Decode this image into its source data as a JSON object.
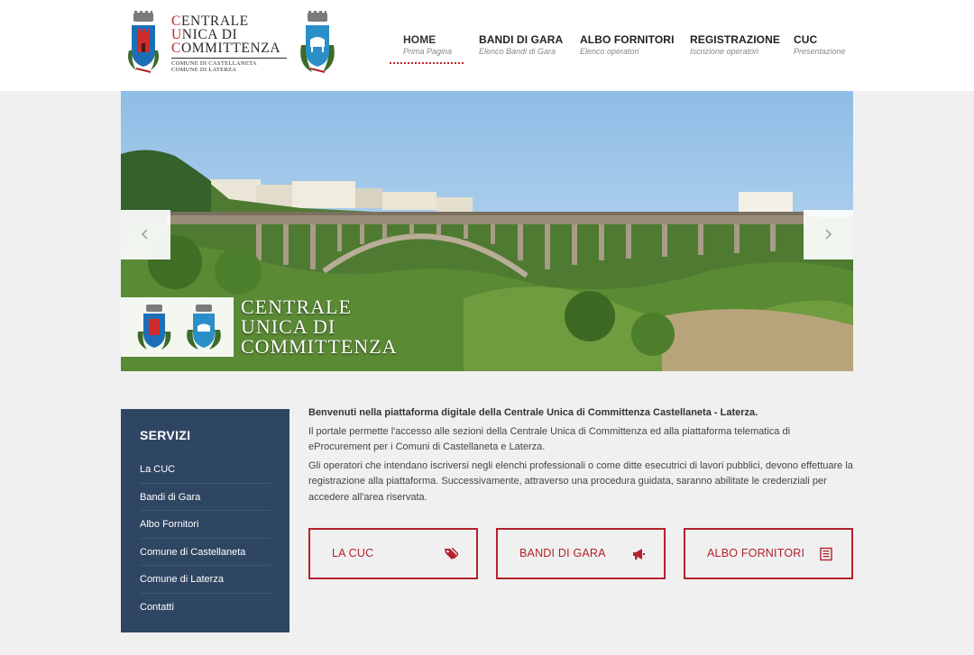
{
  "logo": {
    "line1_initial": "C",
    "line1_rest": "ENTRALE",
    "line2_initial": "U",
    "line2_rest": "NICA DI",
    "line3_initial": "C",
    "line3_rest": "OMMITTENZA",
    "sub1": "COMUNE DI CASTELLANETA",
    "sub2": "COMUNE DI LATERZA"
  },
  "nav": [
    {
      "label": "HOME",
      "sub": "Prima Pagina",
      "active": true
    },
    {
      "label": "BANDI DI GARA",
      "sub": "Elenco Bandi di Gara",
      "active": false
    },
    {
      "label": "ALBO FORNITORI",
      "sub": "Elenco operatori",
      "active": false
    },
    {
      "label": "REGISTRAZIONE",
      "sub": "Iscrizione operatori",
      "active": false
    },
    {
      "label": "CUC",
      "sub": "Presentazione",
      "active": false
    }
  ],
  "slider": {
    "title_line1": "CENTRALE",
    "title_line2": "UNICA DI",
    "title_line3": "COMMITTENZA",
    "prev_icon": "chevron-left-icon",
    "next_icon": "chevron-right-icon"
  },
  "sidebar": {
    "title": "SERVIZI",
    "items": [
      "La CUC",
      "Bandi di Gara",
      "Albo Fornitori",
      "Comune di Castellaneta",
      "Comune di Laterza",
      "Contatti"
    ]
  },
  "content": {
    "lead": "Benvenuti nella piattaforma digitale della Centrale Unica di Committenza Castellaneta - Laterza.",
    "p1": "Il portale permette l'accesso alle sezioni della Centrale Unica di Committenza ed alla piattaforma telematica di eProcurement per i Comuni di Castellaneta e Laterza.",
    "p2": "Gli operatori che intendano iscriversi negli elenchi professionali o come ditte esecutrici di lavori pubblici, devono effettuare la registrazione alla piattaforma. Successivamente, attraverso una procedura guidata, saranno abilitate le credenziali per accedere all'area riservata."
  },
  "tiles": [
    {
      "label": "LA CUC",
      "icon": "tags-icon"
    },
    {
      "label": "BANDI DI GARA",
      "icon": "bullhorn-icon"
    },
    {
      "label": "ALBO FORNITORI",
      "icon": "list-icon"
    }
  ],
  "colors": {
    "accent": "#b3222a",
    "sidebar": "#2f4663",
    "background": "#f0f0f1"
  }
}
